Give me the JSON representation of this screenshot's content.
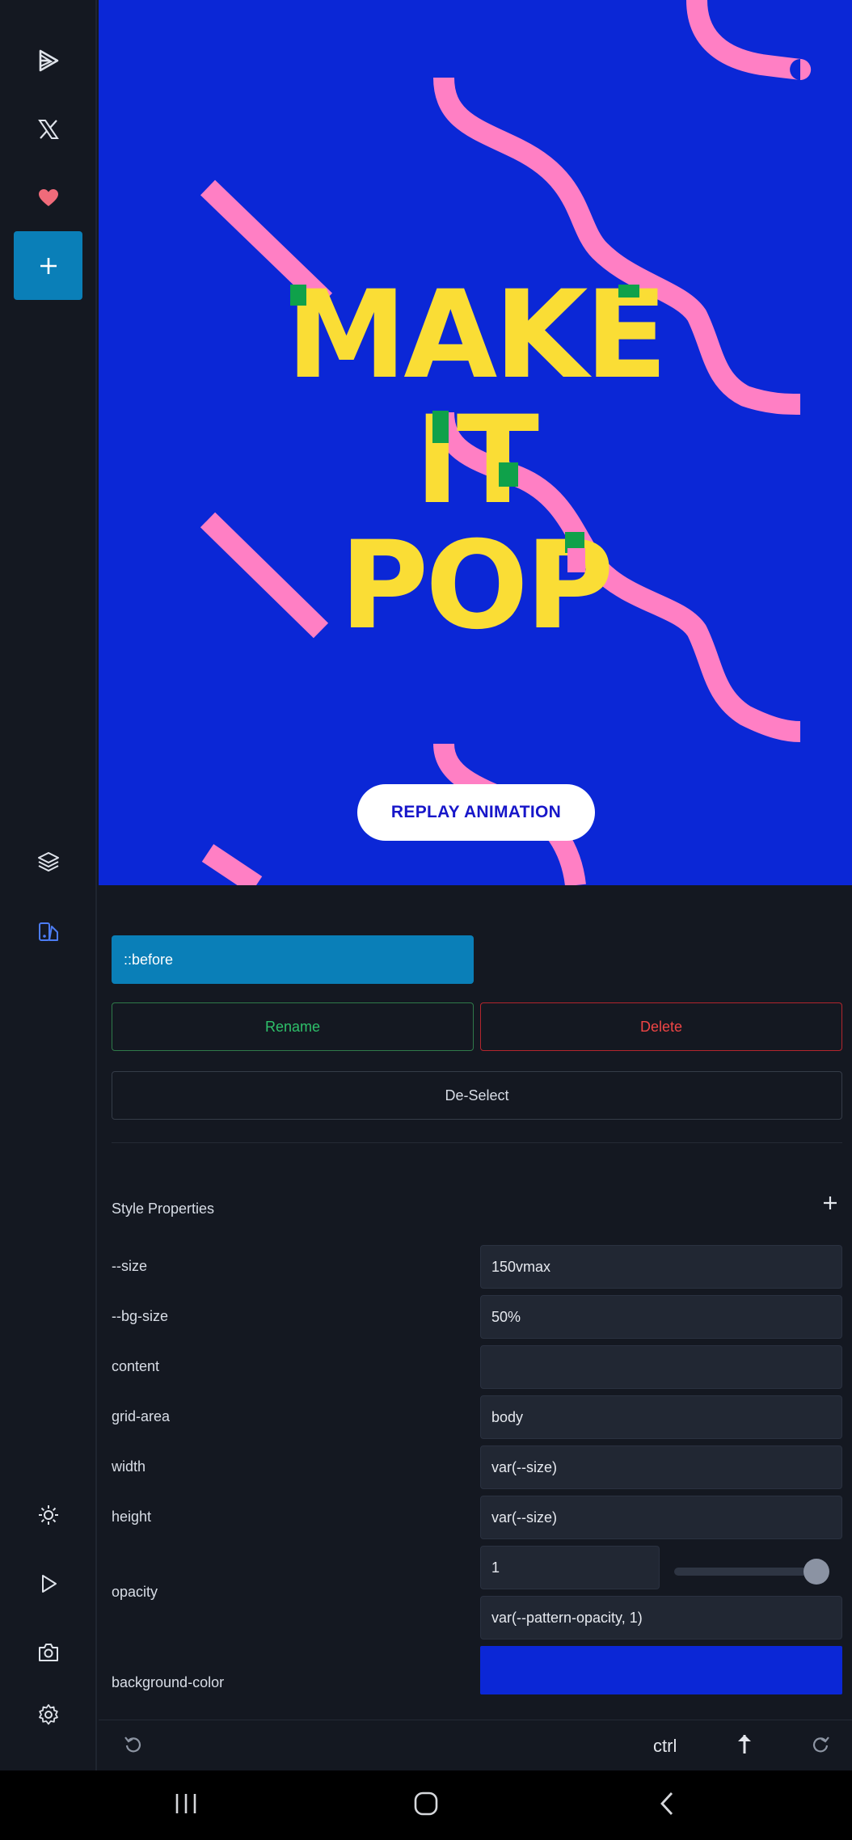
{
  "sidebar": {
    "icons": [
      "codepen-play-icon",
      "x-logo-icon",
      "heart-icon",
      "plus-icon",
      "layers-icon",
      "style-editor-icon",
      "sun-icon",
      "play-icon",
      "camera-icon",
      "gear-icon"
    ],
    "accent": "#0a7fb8"
  },
  "preview": {
    "headline": [
      "MAKE",
      "IT",
      "POP"
    ],
    "replay_label": "REPLAY ANIMATION",
    "background": "#0b27d6",
    "text_color": "#fadd35",
    "shape_color": "#ff7fc4",
    "highlight_color": "#0fa14a"
  },
  "panel": {
    "selected_element": "::before",
    "rename_label": "Rename",
    "delete_label": "Delete",
    "deselect_label": "De-Select",
    "section_title": "Style Properties",
    "properties": [
      {
        "name": "--size",
        "value": "150vmax"
      },
      {
        "name": "--bg-size",
        "value": "50%"
      },
      {
        "name": "content",
        "value": ""
      },
      {
        "name": "grid-area",
        "value": "body"
      },
      {
        "name": "width",
        "value": "var(--size)"
      },
      {
        "name": "height",
        "value": "var(--size)"
      }
    ],
    "opacity": {
      "name": "opacity",
      "number": "1",
      "slider_value": 1,
      "expression": "var(--pattern-opacity, 1)"
    },
    "background_color": {
      "name": "background-color",
      "value": "#0b27d6"
    }
  },
  "toolbar": {
    "ctrl_label": "ctrl",
    "icons": [
      "undo-icon",
      "arrow-up-icon",
      "redo-icon"
    ]
  },
  "navbar": {
    "icons": [
      "recent-apps-icon",
      "home-icon",
      "back-icon"
    ]
  }
}
